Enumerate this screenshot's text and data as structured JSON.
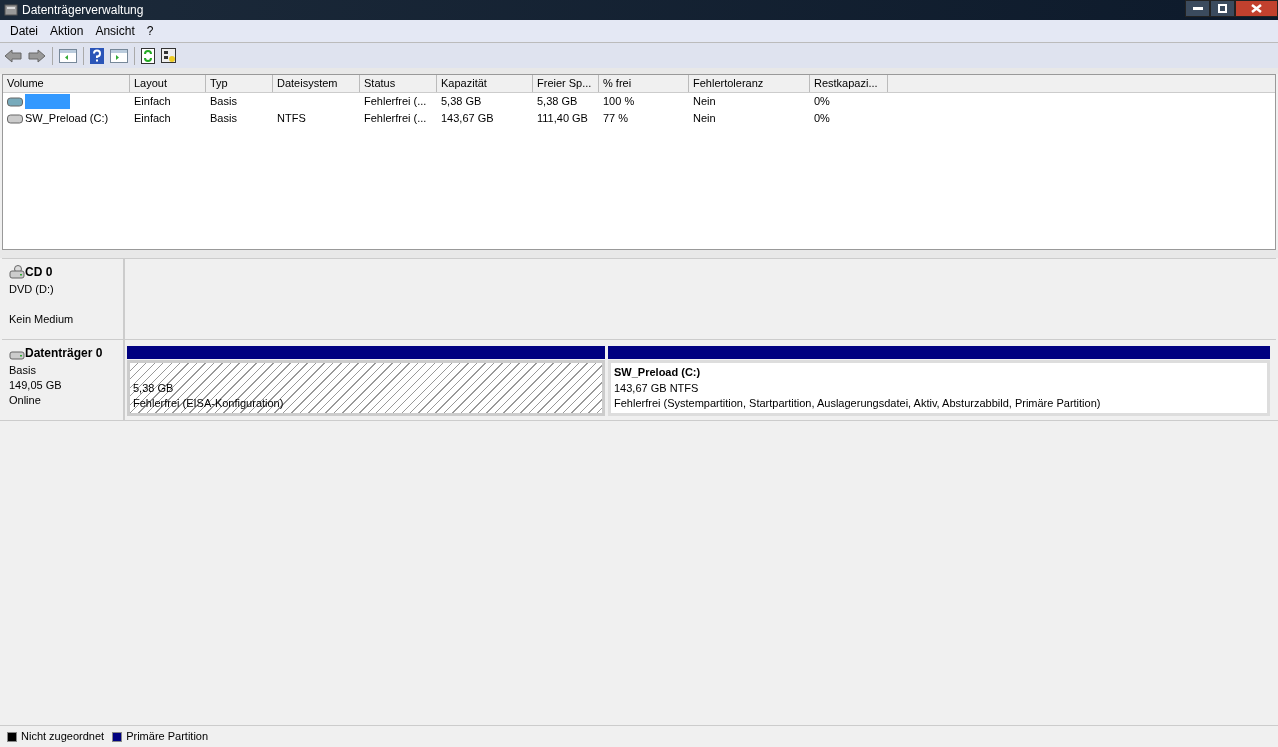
{
  "window": {
    "title": "Datenträgerverwaltung"
  },
  "menu": [
    "Datei",
    "Aktion",
    "Ansicht",
    "?"
  ],
  "table": {
    "columns": [
      "Volume",
      "Layout",
      "Typ",
      "Dateisystem",
      "Status",
      "Kapazität",
      "Freier Sp...",
      "% frei",
      "Fehlertoleranz",
      "Restkapazi..."
    ],
    "rows": [
      {
        "selected": true,
        "cells": [
          "",
          "Einfach",
          "Basis",
          "",
          "Fehlerfrei (...",
          "5,38 GB",
          "5,38 GB",
          "100 %",
          "Nein",
          "0%"
        ]
      },
      {
        "selected": false,
        "cells": [
          "SW_Preload (C:)",
          "Einfach",
          "Basis",
          "NTFS",
          "Fehlerfrei (...",
          "143,67 GB",
          "111,40 GB",
          "77 %",
          "Nein",
          "0%"
        ]
      }
    ]
  },
  "disks": [
    {
      "name": "CD 0",
      "kind": "cd",
      "lines": [
        "DVD (D:)"
      ],
      "note": "Kein Medium"
    },
    {
      "name": "Datenträger 0",
      "kind": "disk",
      "lines": [
        "Basis",
        "149,05 GB",
        "Online"
      ],
      "partitions": [
        {
          "kind": "hatched",
          "lines": [
            "5,38 GB",
            "Fehlerfrei (EISA-Konfiguration)"
          ]
        },
        {
          "kind": "primary",
          "title": "SW_Preload  (C:)",
          "lines": [
            "143,67 GB NTFS",
            "Fehlerfrei (Systempartition, Startpartition, Auslagerungsdatei, Aktiv, Absturzabbild, Primäre Partition)"
          ]
        }
      ]
    }
  ],
  "legend": [
    {
      "label": "Nicht zugeordnet",
      "color": "#000000"
    },
    {
      "label": "Primäre Partition",
      "color": "#000080"
    }
  ]
}
